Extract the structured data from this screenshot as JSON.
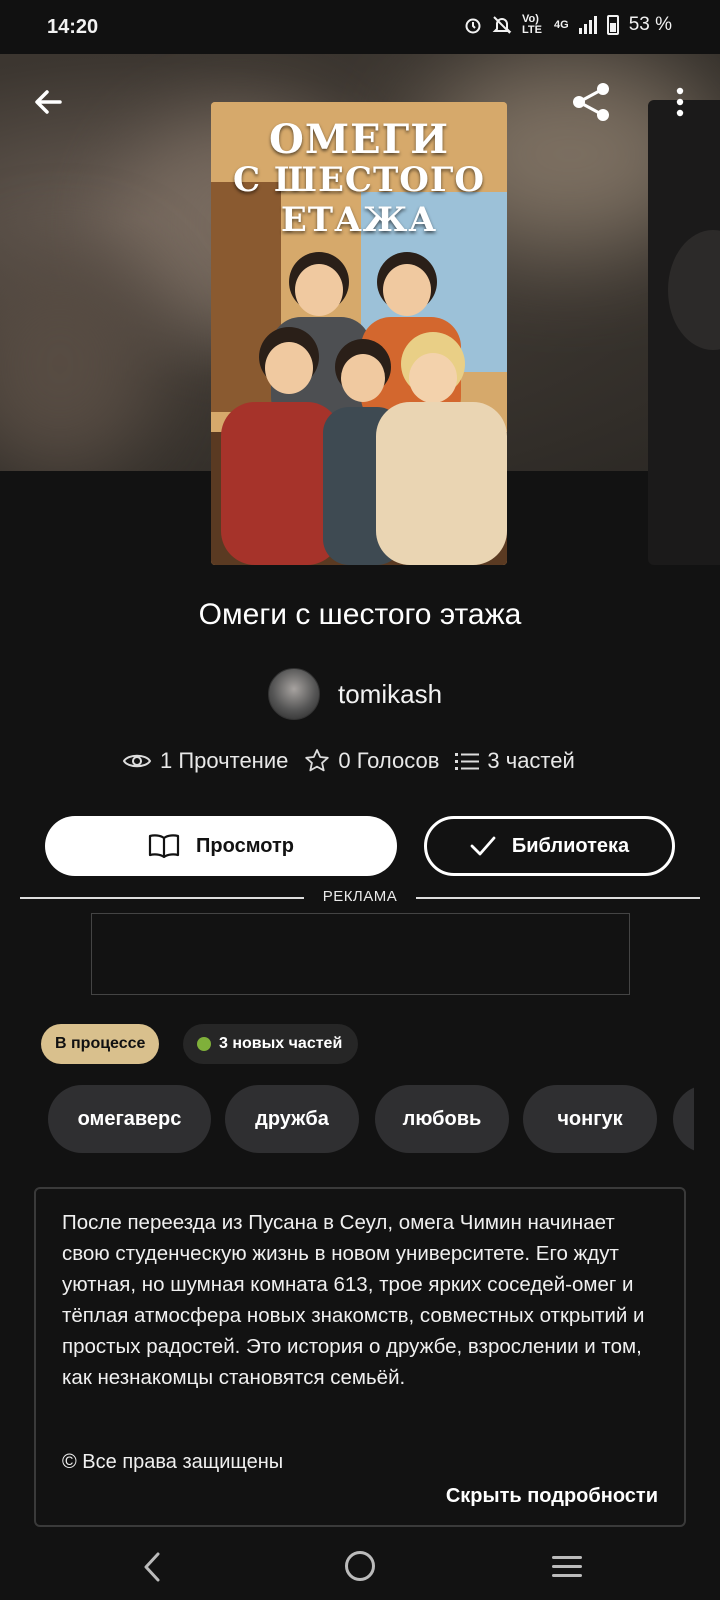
{
  "status_bar": {
    "time": "14:20",
    "network_volte": "Vo) LTE",
    "network_type": "4G",
    "battery": "53 %",
    "icons": [
      "alarm-icon",
      "mute-icon",
      "signal-icon",
      "battery-icon"
    ]
  },
  "header": {
    "back_icon": "arrow-left-icon",
    "share_icon": "share-icon",
    "more_icon": "more-vertical-icon"
  },
  "cover": {
    "title_lines": [
      "ОМЕГИ",
      "С ШЕСТОГО",
      "ЕТАЖА"
    ]
  },
  "book": {
    "title": "Омеги с шестого этажа",
    "author": "tomikash",
    "stats": {
      "reads": "1 Прочтение",
      "votes": "0 Голосов",
      "parts": "3 частей"
    }
  },
  "actions": {
    "view_label": "Просмотр",
    "library_label": "Библиотека"
  },
  "ad": {
    "label": "РЕКЛАМА"
  },
  "badges": {
    "status": "В процессе",
    "new_parts": "3 новых частей",
    "new_dot_color": "#7fb03a"
  },
  "tags": [
    "омегаверс",
    "дружба",
    "любовь",
    "чонгук"
  ],
  "description": {
    "text": "После переезда из Пусана в Сеул, омега Чимин начинает свою студенческую жизнь в новом университете. Его ждут уютная, но шумная комната 613, трое ярких соседей-омег и тёплая атмосфера новых знакомств, совместных открытий и простых радостей. Это история о дружбе, взрослении и том, как незнакомцы становятся семьёй.",
    "rights": "© Все права защищены",
    "hide_label": "Скрыть подробности"
  },
  "colors": {
    "background": "#121212",
    "status_badge": "#d9c08d",
    "tag_bg": "#2f2f31"
  }
}
